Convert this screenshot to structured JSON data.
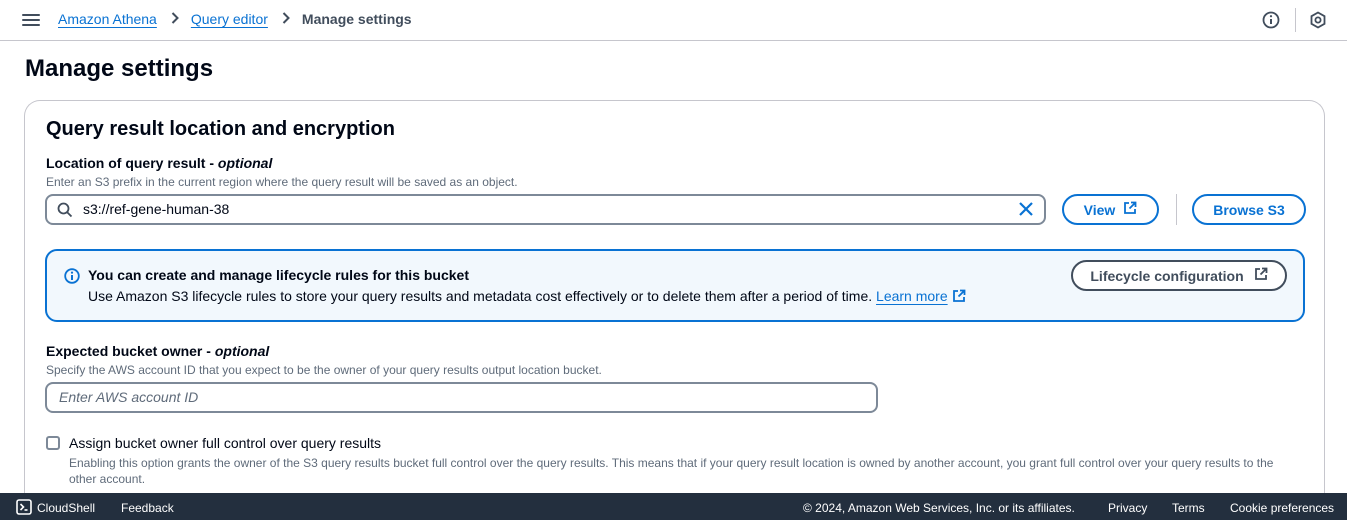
{
  "breadcrumb": {
    "items": [
      "Amazon Athena",
      "Query editor"
    ],
    "current": "Manage settings"
  },
  "page": {
    "title": "Manage settings"
  },
  "section": {
    "title": "Query result location and encryption",
    "location": {
      "label": "Location of query result",
      "label_suffix": "optional",
      "description": "Enter an S3 prefix in the current region where the query result will be saved as an object.",
      "value": "s3://ref-gene-human-38",
      "view_button": "View",
      "browse_button": "Browse S3"
    },
    "info": {
      "title": "You can create and manage lifecycle rules for this bucket",
      "text": "Use Amazon S3 lifecycle rules to store your query results and metadata cost effectively or to delete them after a period of time.",
      "link": "Learn more",
      "button": "Lifecycle configuration"
    },
    "owner": {
      "label": "Expected bucket owner",
      "label_suffix": "optional",
      "description": "Specify the AWS account ID that you expect to be the owner of your query results output location bucket.",
      "placeholder": "Enter AWS account ID"
    },
    "checkbox": {
      "label": "Assign bucket owner full control over query results",
      "description": "Enabling this option grants the owner of the S3 query results bucket full control over the query results. This means that if your query result location is owned by another account, you grant full control over your query results to the other account.",
      "checked": false
    }
  },
  "footer": {
    "cloudshell": "CloudShell",
    "feedback": "Feedback",
    "copyright": "© 2024, Amazon Web Services, Inc. or its affiliates.",
    "privacy": "Privacy",
    "terms": "Terms",
    "cookies": "Cookie preferences"
  },
  "colors": {
    "link": "#0972d3",
    "footer_bg": "#232f3e",
    "info_bg": "#f2f8fd",
    "text": "#000716",
    "muted": "#5f6b7a"
  }
}
